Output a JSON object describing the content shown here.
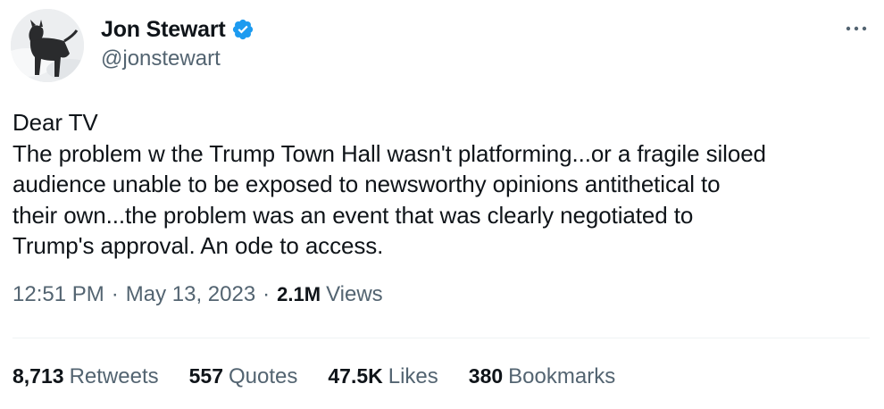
{
  "author": {
    "display_name": "Jon Stewart",
    "handle": "@jonstewart",
    "avatar_icon": "dog-avatar",
    "verified_icon": "verified-badge-icon",
    "verified_color": "#1d9bf0"
  },
  "tweet": {
    "lines": [
      "Dear TV",
      "The problem w the Trump Town Hall wasn't platforming...or a fragile siloed",
      "audience unable to be exposed to newsworthy opinions antithetical to",
      "their own...the problem was an event that was clearly negotiated to",
      "Trump's approval. An ode to access."
    ]
  },
  "meta": {
    "time": "12:51 PM",
    "separator": "·",
    "date": "May 13, 2023",
    "views_count": "2.1M",
    "views_label": "Views"
  },
  "stats": [
    {
      "count": "8,713",
      "label": "Retweets"
    },
    {
      "count": "557",
      "label": "Quotes"
    },
    {
      "count": "47.5K",
      "label": "Likes"
    },
    {
      "count": "380",
      "label": "Bookmarks"
    }
  ],
  "colors": {
    "text_primary": "#0f1419",
    "text_secondary": "#536471",
    "divider": "#eff3f4"
  },
  "more_icon": "more-horizontal-icon"
}
